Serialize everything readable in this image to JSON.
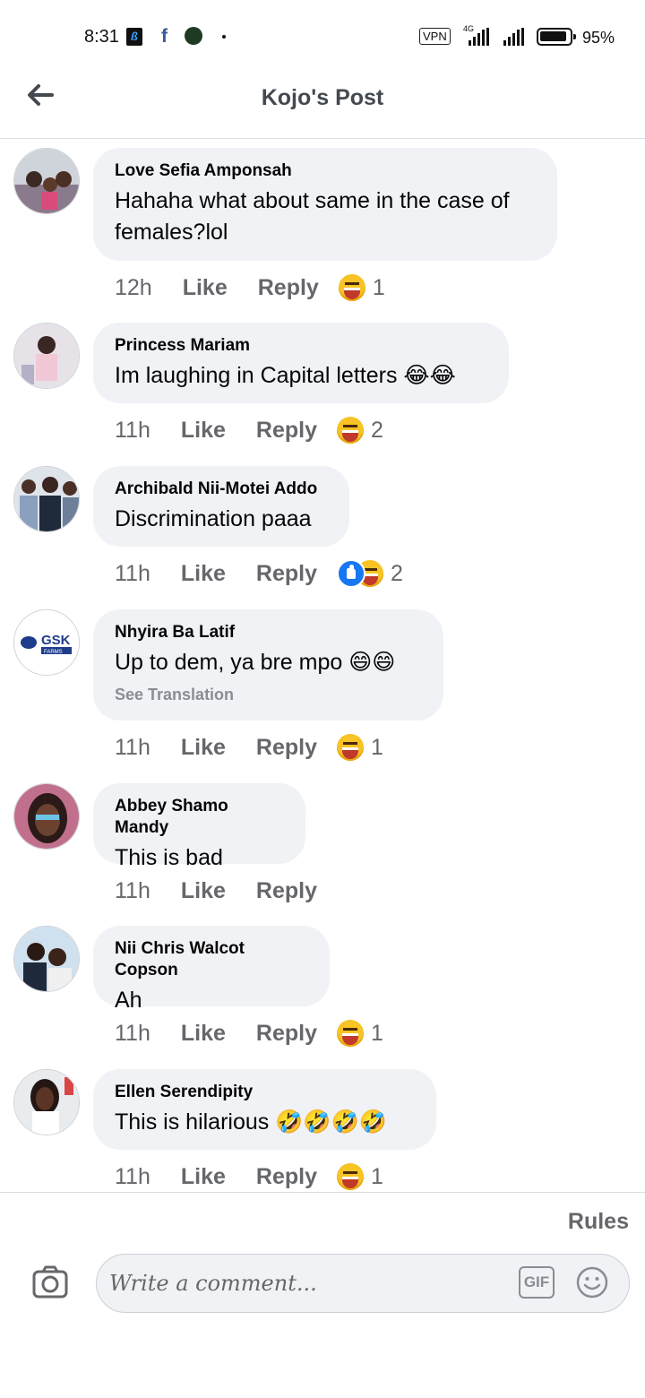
{
  "status_bar": {
    "time": "8:31",
    "vpn": "VPN",
    "network": "4G",
    "battery_level": 0.95,
    "battery_text": "95%"
  },
  "header": {
    "title": "Kojo's Post",
    "back_icon": "arrow-left-icon"
  },
  "comments": [
    {
      "name": "Love Sefia Amponsah",
      "text": "Hahaha what about same in the case of females?lol",
      "time": "12h",
      "like": "Like",
      "reply": "Reply",
      "reactions": [
        "haha"
      ],
      "count": "1"
    },
    {
      "name": "Princess Mariam",
      "text": "Im laughing in Capital letters 😂😂",
      "time": "11h",
      "like": "Like",
      "reply": "Reply",
      "reactions": [
        "haha"
      ],
      "count": "2"
    },
    {
      "name": "Archibald Nii-Motei Addo",
      "text": "Discrimination paaa",
      "time": "11h",
      "like": "Like",
      "reply": "Reply",
      "reactions": [
        "like",
        "haha"
      ],
      "count": "2"
    },
    {
      "name": "Nhyira Ba Latif",
      "text": "Up to dem, ya bre mpo 😄😄",
      "translate": "See Translation",
      "time": "11h",
      "like": "Like",
      "reply": "Reply",
      "reactions": [
        "haha"
      ],
      "count": "1"
    },
    {
      "name": "Abbey Shamo Mandy",
      "text": "This is bad",
      "time": "11h",
      "like": "Like",
      "reply": "Reply",
      "reactions": [],
      "count": ""
    },
    {
      "name": "Nii Chris Walcot Copson",
      "text": "Ah",
      "time": "11h",
      "like": "Like",
      "reply": "Reply",
      "reactions": [
        "haha"
      ],
      "count": "1"
    },
    {
      "name": "Ellen Serendipity",
      "text": "This is hilarious 🤣🤣🤣🤣",
      "time": "11h",
      "like": "Like",
      "reply": "Reply",
      "reactions": [
        "haha"
      ],
      "count": "1"
    }
  ],
  "avatar_logo_text": "GSK FARMS",
  "footer": {
    "rules": "Rules",
    "compose_placeholder": "Write a comment...",
    "gif": "GIF"
  },
  "colors": {
    "bubble": "#f0f2f5",
    "meta": "#65676b",
    "like_blue": "#1877f2",
    "haha_yellow": "#f7c325"
  }
}
